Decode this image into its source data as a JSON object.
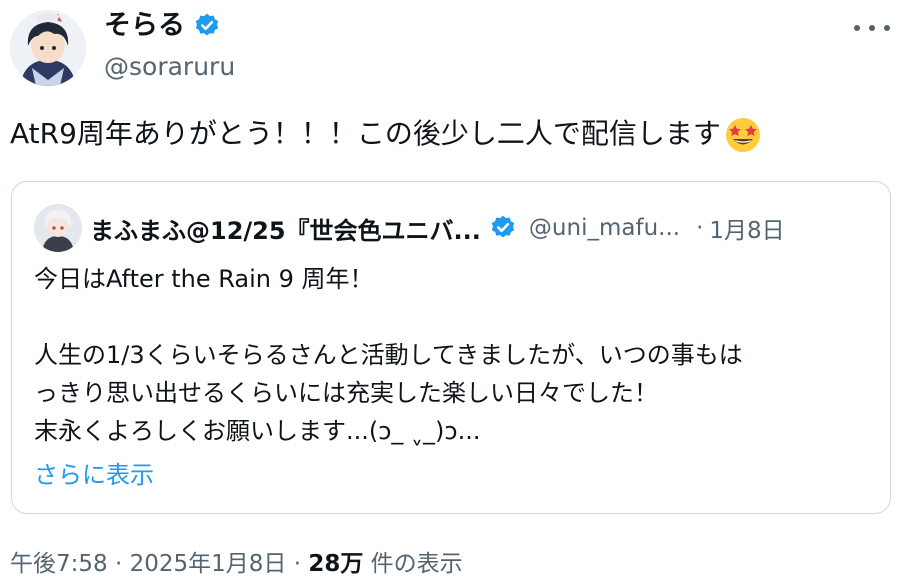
{
  "author": {
    "name": "そらる",
    "handle": "@soraruru",
    "verified": true
  },
  "tweet": {
    "text": "AtR9周年ありがとう！！！この後少し二人で配信します",
    "emoji": "star-struck-emoji"
  },
  "quote": {
    "author_name": "まふまふ@12/25『世会色ユニバ...",
    "author_handle": "@uni_mafu...",
    "separator": "·",
    "date": "1月8日",
    "verified": true,
    "lines": [
      "今日はAfter the Rain 9 周年！",
      "",
      "人生の1/3くらいそらるさんと活動してきましたが、いつの事もは",
      "っきり思い出せるくらいには充実した楽しい日々でした！",
      "末永くよろしくお願いします...(ͻ_ ˬ_)ͻ..."
    ],
    "show_more": "さらに表示"
  },
  "footer": {
    "time": "午後7:58",
    "sep1": "·",
    "date": "2025年1月8日",
    "sep2": "·",
    "views_count": "28万",
    "views_label": "件の表示"
  },
  "colors": {
    "text": "#0f1419",
    "secondary": "#536471",
    "link": "#1d9bf0",
    "border": "#cfd9de",
    "verified": "#1d9bf0"
  }
}
